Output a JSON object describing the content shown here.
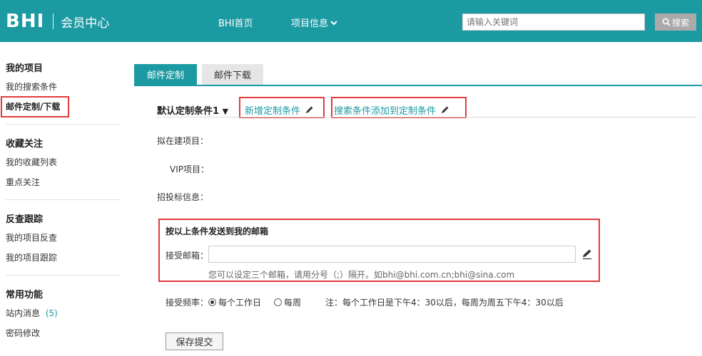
{
  "header": {
    "logo_mark": "BHI",
    "logo_text": "会员中心",
    "nav": [
      "BHI首页",
      "项目信息"
    ],
    "search_placeholder": "请输入关键词",
    "search_button": "搜索"
  },
  "sidebar": {
    "groups": [
      {
        "title": "我的项目",
        "items": [
          "我的搜索条件",
          "邮件定制/下载"
        ]
      },
      {
        "title": "收藏关注",
        "items": [
          "我的收藏列表",
          "重点关注"
        ]
      },
      {
        "title": "反查跟踪",
        "items": [
          "我的项目反查",
          "我的项目跟踪"
        ]
      },
      {
        "title": "常用功能",
        "items": [
          "站内消息",
          "密码修改"
        ]
      }
    ],
    "message_count": "(5)"
  },
  "tabs": [
    "邮件定制",
    "邮件下载"
  ],
  "conditions": {
    "default_label": "默认定制条件1",
    "add_link": "新增定制条件",
    "add_search_link": "搜索条件添加到定制条件"
  },
  "fields": {
    "planned_label": "拟在建项目：",
    "vip_label": "VIP项目：",
    "bid_label": "招投标信息："
  },
  "email_section": {
    "title": "按以上条件发送到我的邮箱",
    "email_label": "接受邮箱：",
    "email_value": "",
    "hint": "您可以设定三个邮箱，请用分号（;）隔开。如bhi@bhi.com.cn;bhi@sina.com"
  },
  "frequency": {
    "label": "接受频率：",
    "options": [
      "每个工作日",
      "每周"
    ],
    "selected": "每个工作日",
    "note": "注：每个工作日是下午4：30以后，每周为周五下午4：30以后"
  },
  "save_button": "保存提交",
  "colors": {
    "brand": "#1c9aa2",
    "highlight_box": "#e23b3b",
    "search_button": "#aaaaaa"
  }
}
